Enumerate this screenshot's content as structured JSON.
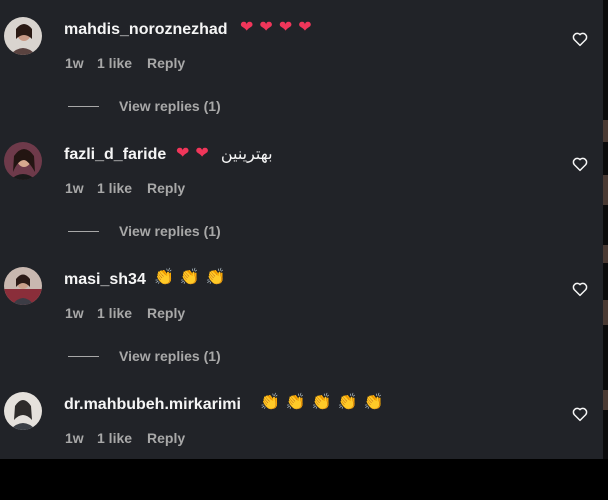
{
  "comments": [
    {
      "username": "mahdis_noroznezhad",
      "emoji": [
        "❤",
        "❤",
        "❤",
        "❤"
      ],
      "time": "1w",
      "likes": "1 like",
      "reply": "Reply",
      "view_replies": "View replies (1)"
    },
    {
      "username": "fazli_d_faride",
      "emoji": [
        "❤",
        "❤"
      ],
      "text": "بهترینین",
      "time": "1w",
      "likes": "1 like",
      "reply": "Reply",
      "view_replies": "View replies (1)"
    },
    {
      "username": "masi_sh34",
      "emoji": [
        "👏",
        "👏",
        "👏"
      ],
      "time": "1w",
      "likes": "1 like",
      "reply": "Reply",
      "view_replies": "View replies (1)"
    },
    {
      "username": "dr.mahbubeh.mirkarimi",
      "emoji": [
        "👏",
        "👏",
        "👏",
        "👏",
        "👏"
      ],
      "time": "1w",
      "likes": "1 like",
      "reply": "Reply"
    }
  ],
  "colors": {
    "background": "#212328",
    "text_primary": "#f5f5f5",
    "text_secondary": "#a8a8a8",
    "heart": "#f0365a",
    "clap": "#f3b733"
  }
}
